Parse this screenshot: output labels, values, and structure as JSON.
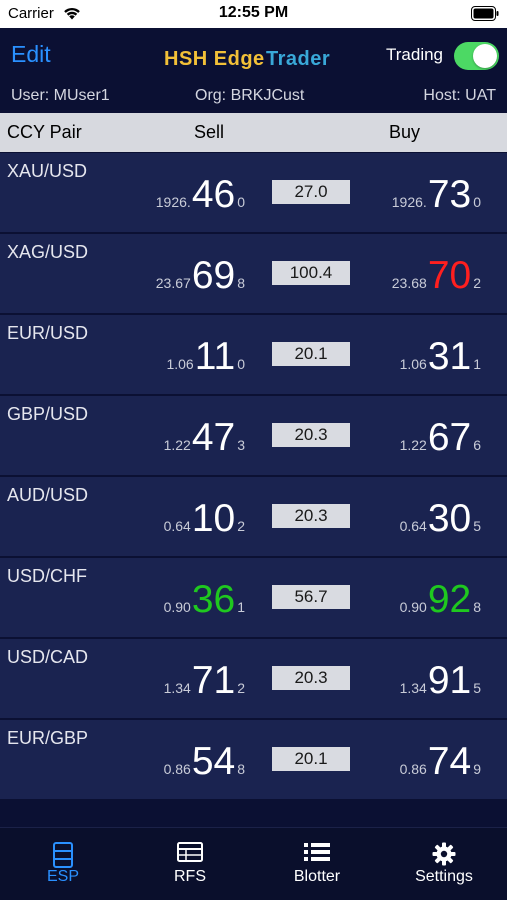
{
  "status_bar": {
    "carrier": "Carrier",
    "time": "12:55 PM"
  },
  "header": {
    "edit_label": "Edit",
    "brand_part1": "HSH Edge",
    "brand_part2": "Trader",
    "trading_label": "Trading",
    "trading_on": true
  },
  "info": {
    "user": "User: MUser1",
    "org": "Org: BRKJCust",
    "host": "Host: UAT"
  },
  "columns": {
    "pair": "CCY Pair",
    "sell": "Sell",
    "buy": "Buy"
  },
  "rows": [
    {
      "pair": "XAU/USD",
      "sell": {
        "prefix": "1926.",
        "big": "46",
        "pip": "0",
        "color": "#ffffff"
      },
      "spread": "27.0",
      "buy": {
        "prefix": "1926.",
        "big": "73",
        "pip": "0",
        "color": "#ffffff"
      }
    },
    {
      "pair": "XAG/USD",
      "sell": {
        "prefix": "23.67",
        "big": "69",
        "pip": "8",
        "color": "#ffffff"
      },
      "spread": "100.4",
      "buy": {
        "prefix": "23.68",
        "big": "70",
        "pip": "2",
        "color": "#ff1f1f"
      }
    },
    {
      "pair": "EUR/USD",
      "sell": {
        "prefix": "1.06",
        "big": "11",
        "pip": "0",
        "color": "#ffffff"
      },
      "spread": "20.1",
      "buy": {
        "prefix": "1.06",
        "big": "31",
        "pip": "1",
        "color": "#ffffff"
      }
    },
    {
      "pair": "GBP/USD",
      "sell": {
        "prefix": "1.22",
        "big": "47",
        "pip": "3",
        "color": "#ffffff"
      },
      "spread": "20.3",
      "buy": {
        "prefix": "1.22",
        "big": "67",
        "pip": "6",
        "color": "#ffffff"
      }
    },
    {
      "pair": "AUD/USD",
      "sell": {
        "prefix": "0.64",
        "big": "10",
        "pip": "2",
        "color": "#ffffff"
      },
      "spread": "20.3",
      "buy": {
        "prefix": "0.64",
        "big": "30",
        "pip": "5",
        "color": "#ffffff"
      }
    },
    {
      "pair": "USD/CHF",
      "sell": {
        "prefix": "0.90",
        "big": "36",
        "pip": "1",
        "color": "#1fc81f"
      },
      "spread": "56.7",
      "buy": {
        "prefix": "0.90",
        "big": "92",
        "pip": "8",
        "color": "#1fc81f"
      }
    },
    {
      "pair": "USD/CAD",
      "sell": {
        "prefix": "1.34",
        "big": "71",
        "pip": "2",
        "color": "#ffffff"
      },
      "spread": "20.3",
      "buy": {
        "prefix": "1.34",
        "big": "91",
        "pip": "5",
        "color": "#ffffff"
      }
    },
    {
      "pair": "EUR/GBP",
      "sell": {
        "prefix": "0.86",
        "big": "54",
        "pip": "8",
        "color": "#ffffff"
      },
      "spread": "20.1",
      "buy": {
        "prefix": "0.86",
        "big": "74",
        "pip": "9",
        "color": "#ffffff"
      }
    }
  ],
  "tabs": [
    {
      "label": "ESP",
      "icon": "esp-icon",
      "active": true
    },
    {
      "label": "RFS",
      "icon": "rfs-icon",
      "active": false
    },
    {
      "label": "Blotter",
      "icon": "blotter-icon",
      "active": false
    },
    {
      "label": "Settings",
      "icon": "gear-icon",
      "active": false
    }
  ],
  "colors": {
    "accent": "#2a90ff",
    "toggle_on": "#4cd964",
    "up": "#1fc81f",
    "down": "#ff1f1f"
  }
}
